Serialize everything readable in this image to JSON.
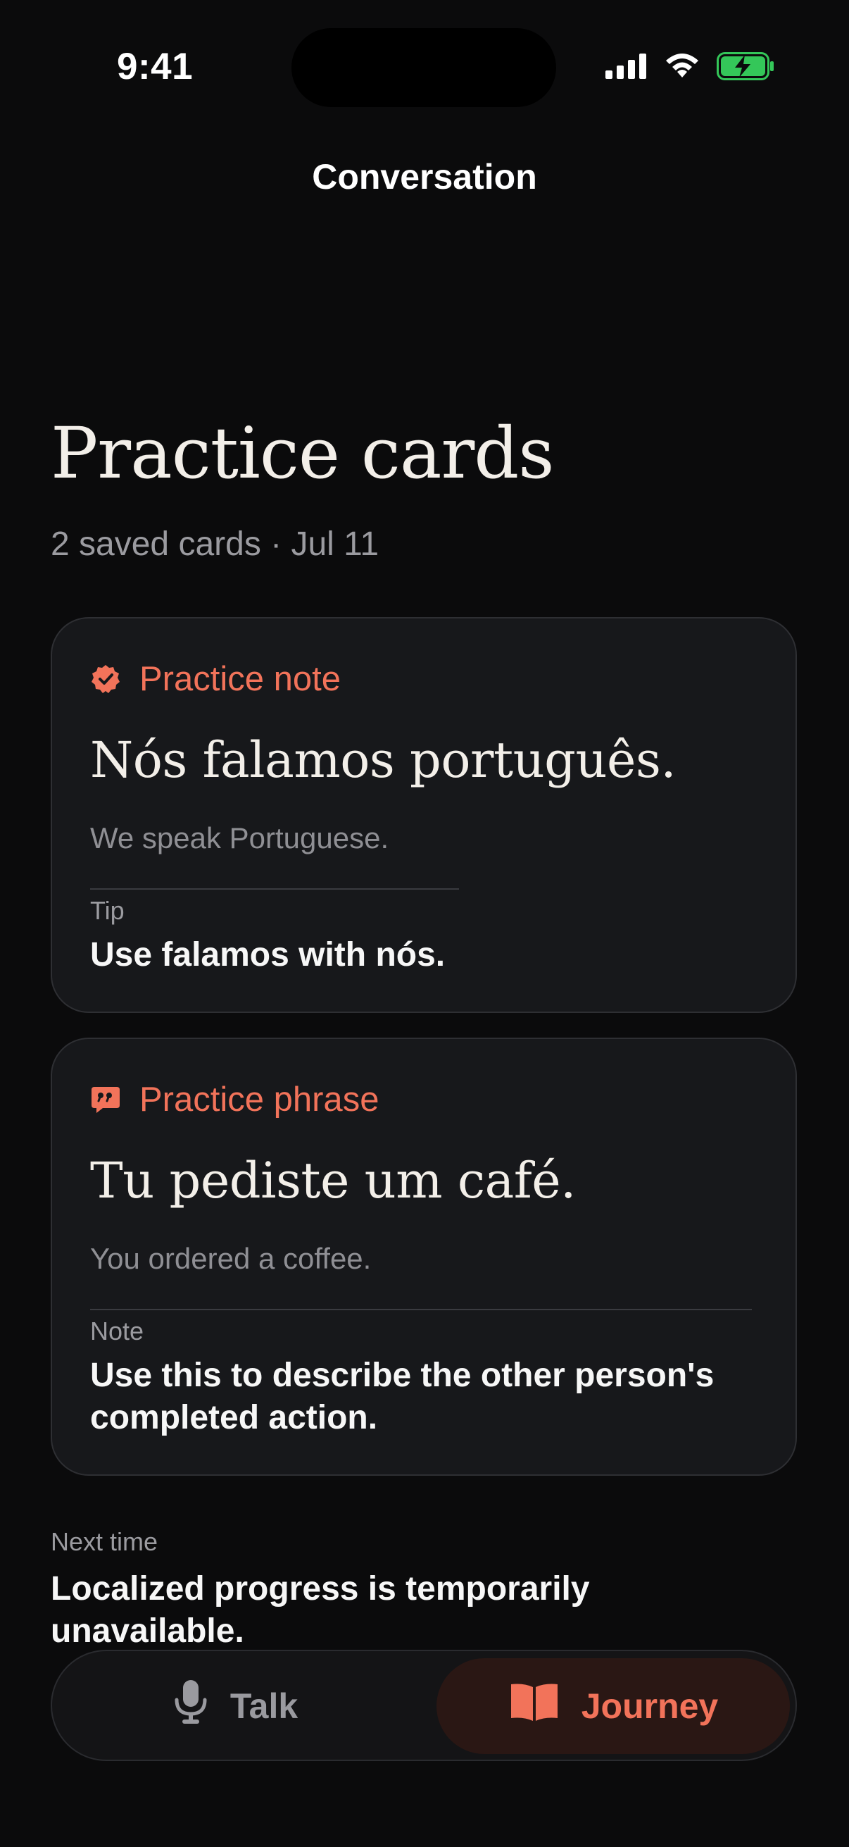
{
  "status_bar": {
    "time": "9:41",
    "icons": [
      "cellular-signal-icon",
      "wifi-icon",
      "battery-charging-icon"
    ],
    "battery_color": "#34c759"
  },
  "nav": {
    "title": "Conversation"
  },
  "header": {
    "title": "Practice cards",
    "subtitle": "2 saved cards · Jul 11"
  },
  "cards": [
    {
      "kind_label": "Practice note",
      "kind_icon": "verified-badge-icon",
      "phrase": "Nós falamos português.",
      "translation": "We speak Portuguese.",
      "note_label": "Tip",
      "note_text": "Use falamos with nós."
    },
    {
      "kind_label": "Practice phrase",
      "kind_icon": "quote-bubble-icon",
      "phrase": "Tu pediste um café.",
      "translation": "You ordered a coffee.",
      "note_label": "Note",
      "note_text": "Use this to describe the other person's completed action."
    }
  ],
  "next_time": {
    "label": "Next time",
    "text": "Localized progress is temporarily unavailable."
  },
  "tab_bar": {
    "tabs": [
      {
        "label": "Talk",
        "icon": "microphone-icon",
        "selected": false
      },
      {
        "label": "Journey",
        "icon": "open-book-icon",
        "selected": true
      }
    ]
  },
  "colors": {
    "accent": "#f2735a",
    "background": "#0b0b0c",
    "card_background": "#17181b"
  }
}
